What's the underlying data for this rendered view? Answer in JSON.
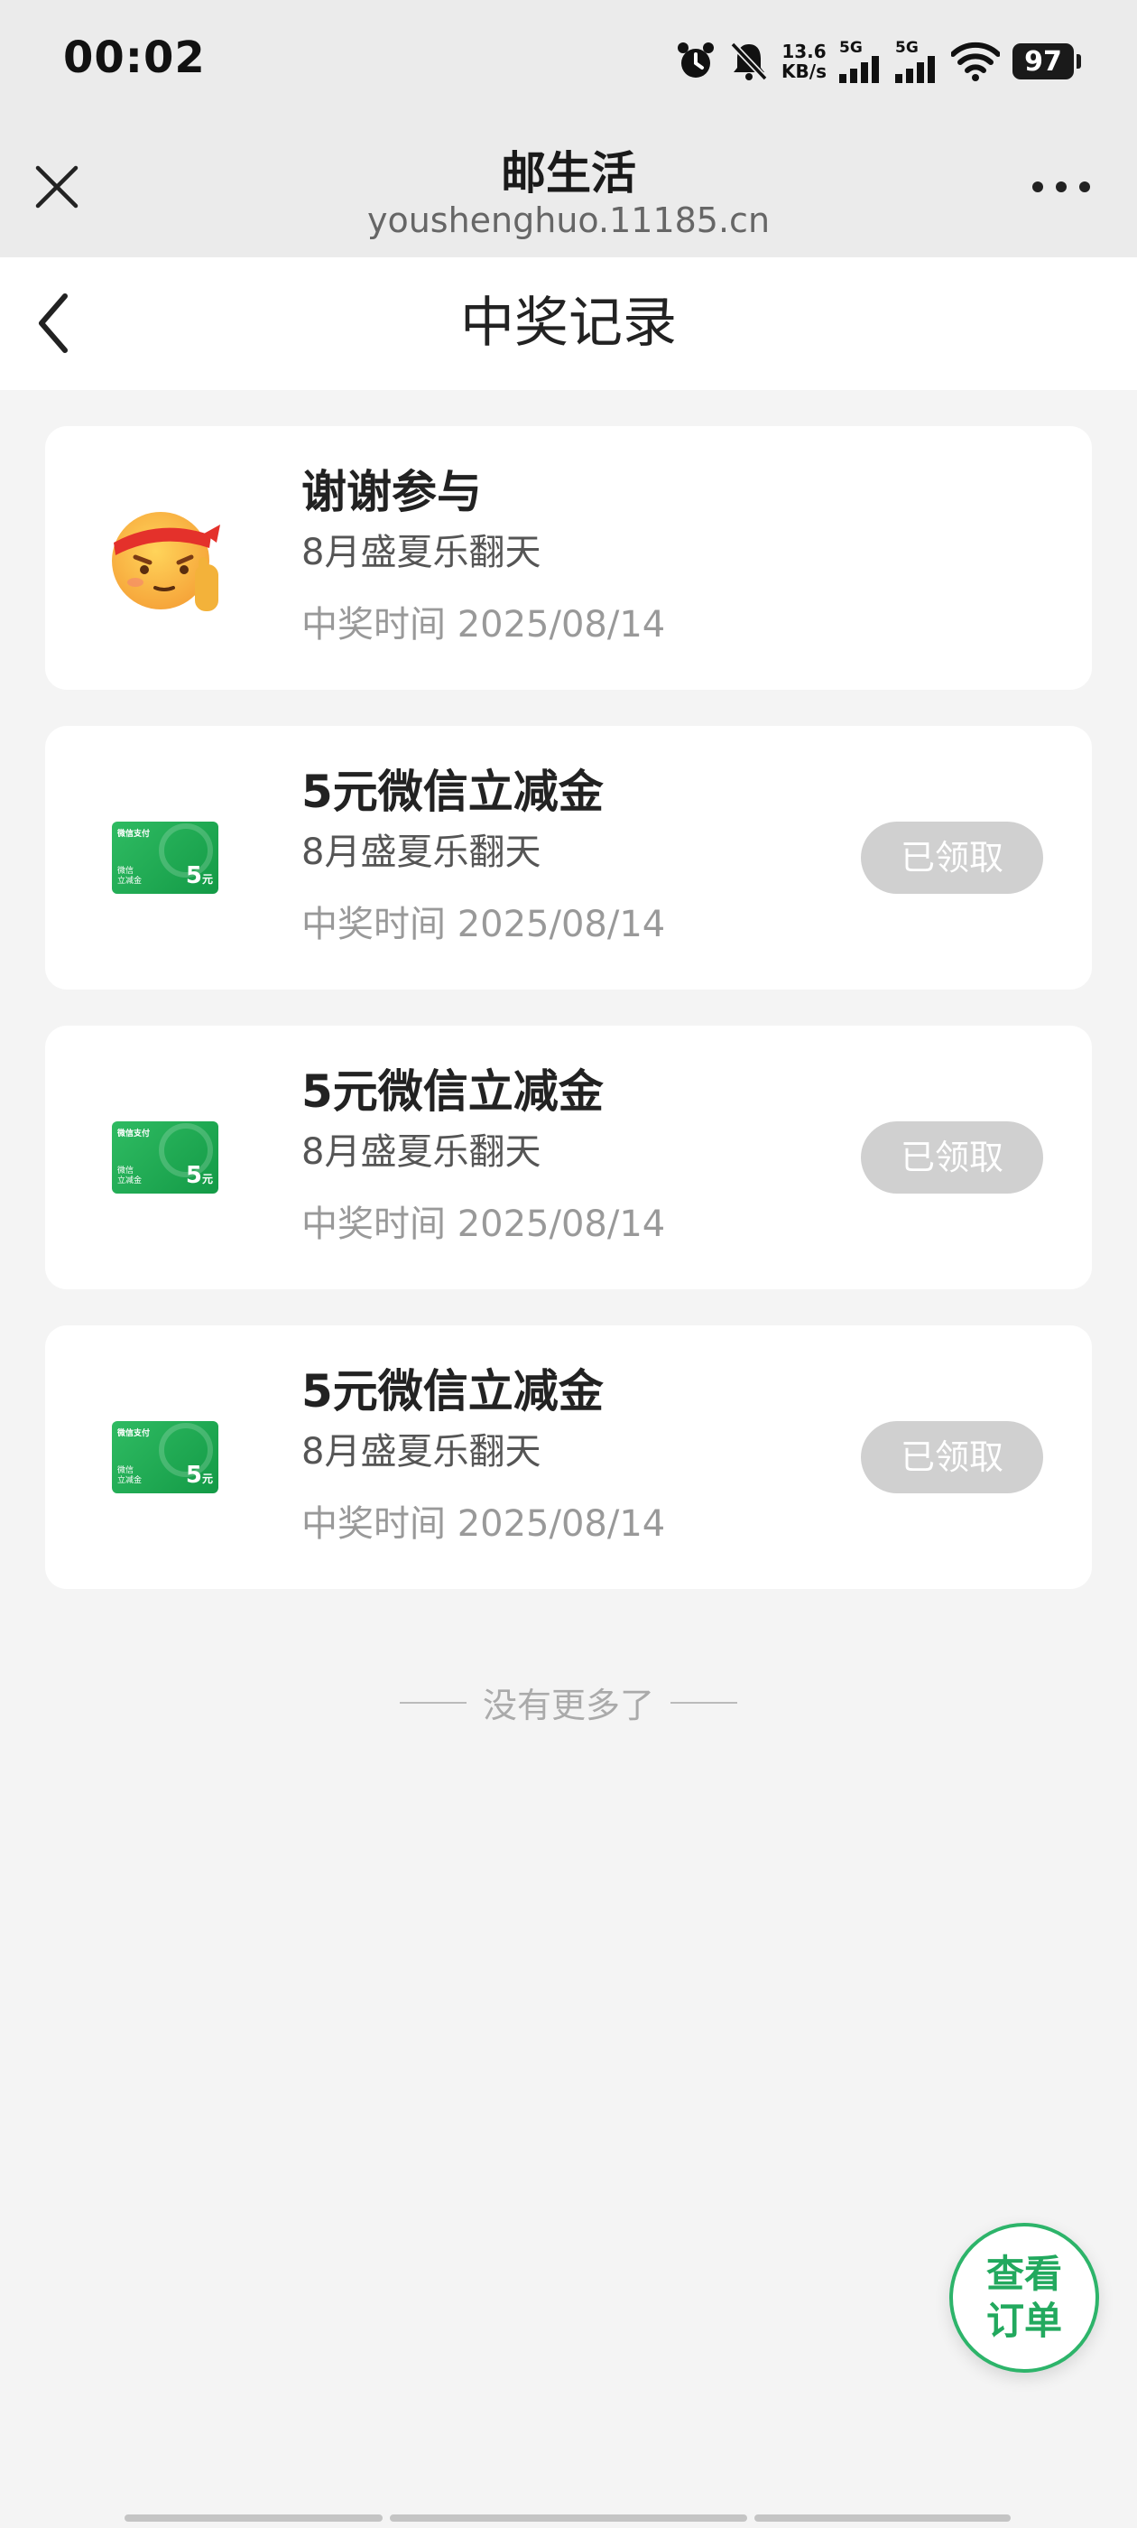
{
  "status_bar": {
    "time": "00:02",
    "net_speed_value": "13.6",
    "net_speed_unit": "KB/s",
    "sim1_label": "5G",
    "sim2_label": "5G",
    "battery": "97"
  },
  "browser": {
    "title": "邮生活",
    "url": "youshenghuo.11185.cn"
  },
  "page": {
    "title": "中奖记录"
  },
  "records": [
    {
      "title": "谢谢参与",
      "event": "8月盛夏乐翻天",
      "time": "中奖时间 2025/08/14",
      "icon": "salute-emoji-icon",
      "button": ""
    },
    {
      "title": "5元微信立减金",
      "event": "8月盛夏乐翻天",
      "time": "中奖时间 2025/08/14",
      "icon": "wechat-voucher-icon",
      "button": "已领取"
    },
    {
      "title": "5元微信立减金",
      "event": "8月盛夏乐翻天",
      "time": "中奖时间 2025/08/14",
      "icon": "wechat-voucher-icon",
      "button": "已领取"
    },
    {
      "title": "5元微信立减金",
      "event": "8月盛夏乐翻天",
      "time": "中奖时间 2025/08/14",
      "icon": "wechat-voucher-icon",
      "button": "已领取"
    }
  ],
  "voucher_image": {
    "logo": "微信支付",
    "tag_line1": "微信",
    "tag_line2": "立减金",
    "amount": "5",
    "unit": "元"
  },
  "footer": {
    "no_more": "没有更多了"
  },
  "fab": {
    "line1": "查看",
    "line2": "订单"
  },
  "colors": {
    "accent_green": "#22a95e",
    "claimed_button": "#d0d0d0",
    "page_background": "#f4f4f4"
  }
}
